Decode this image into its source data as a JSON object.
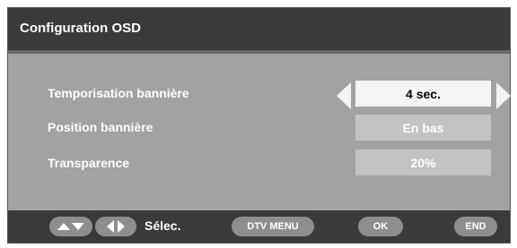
{
  "window": {
    "title": "Configuration OSD"
  },
  "settings": [
    {
      "label": "Temporisation bannière",
      "value": "4 sec."
    },
    {
      "label": "Position bannière",
      "value": "En bas"
    },
    {
      "label": "Transparence",
      "value": "20%"
    }
  ],
  "footer": {
    "select_label": "Sélec.",
    "menu_label": "DTV MENU",
    "ok_label": "OK",
    "end_label": "END"
  },
  "colors": {
    "panel": "#a2a2a2",
    "bars": "#3a3a3a",
    "active_value": "#f4f4f4",
    "inactive_value": "#c3c3c3",
    "footer_button": "#8e8e8e"
  },
  "icons": [
    "arrow-left-icon",
    "arrow-right-icon",
    "up-down-icon",
    "left-right-icon"
  ]
}
